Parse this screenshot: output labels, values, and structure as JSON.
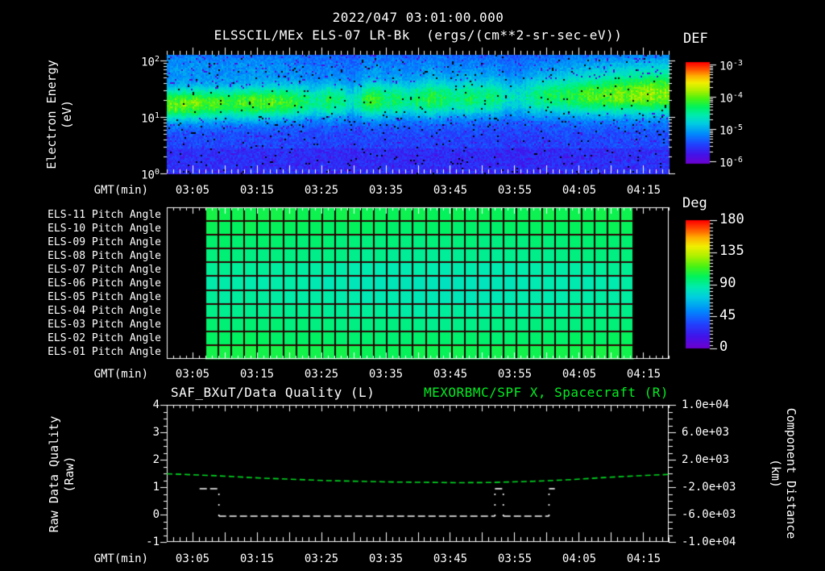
{
  "page": {
    "bg": "#000000",
    "text_color": "#ffffff",
    "accent_green": "#00ee22"
  },
  "header": {
    "title_line1": "2022/047 03:01:00.000",
    "title_line2": "ELSSCIL/MEx ELS-07 LR-Bk  (ergs/(cm**2-sr-sec-eV))"
  },
  "time_axis": {
    "label": "GMT(min)",
    "tick_labels": [
      "03:05",
      "03:15",
      "03:25",
      "03:35",
      "03:45",
      "03:55",
      "04:05",
      "04:15"
    ],
    "start_gmt": "03:01",
    "end_gmt": "04:19",
    "minutes_span": 78
  },
  "panel1": {
    "axis_title_line1": "Electron Energy",
    "axis_title_line2": "(eV)",
    "y_ticks": [
      {
        "base": "10",
        "exp": "2"
      },
      {
        "base": "10",
        "exp": "1"
      },
      {
        "base": "10",
        "exp": "0"
      }
    ],
    "colorbar": {
      "title": "DEF",
      "ticks": [
        {
          "base": "10",
          "exp": "-3"
        },
        {
          "base": "10",
          "exp": "-4"
        },
        {
          "base": "10",
          "exp": "-5"
        },
        {
          "base": "10",
          "exp": "-6"
        }
      ]
    }
  },
  "panel2": {
    "row_labels": [
      "ELS-11 Pitch Angle",
      "ELS-10 Pitch Angle",
      "ELS-09 Pitch Angle",
      "ELS-08 Pitch Angle",
      "ELS-07 Pitch Angle",
      "ELS-06 Pitch Angle",
      "ELS-05 Pitch Angle",
      "ELS-04 Pitch Angle",
      "ELS-03 Pitch Angle",
      "ELS-02 Pitch Angle",
      "ELS-01 Pitch Angle"
    ],
    "colorbar": {
      "title": "Deg",
      "ticks": [
        "180",
        "135",
        "90",
        "45",
        "0"
      ]
    }
  },
  "panel3": {
    "title_left": "SAF_BXuT/Data Quality (L)",
    "title_right": "MEXORBMC/SPF X, Spacecraft (R)",
    "left_axis": {
      "line1": "Raw Data Quality",
      "line2": "(Raw)",
      "ticks": [
        "4",
        "3",
        "2",
        "1",
        "0",
        "-1"
      ]
    },
    "right_axis": {
      "line1": "Component Distance",
      "line2": "(km)",
      "ticks": [
        "1.0e+04",
        "6.0e+03",
        "2.0e+03",
        "-2.0e+03",
        "-6.0e+03",
        "-1.0e+04"
      ]
    }
  },
  "chart_data": [
    {
      "id": "electron_energy_spectrogram",
      "type": "heatmap",
      "title": "ELSSCIL/MEx ELS-07 LR-Bk",
      "units": "ergs/(cm**2-sr-sec-eV)",
      "x_start_gmt": "03:01",
      "x_end_gmt": "04:19",
      "x_tick_labels": [
        "03:05",
        "03:15",
        "03:25",
        "03:35",
        "03:45",
        "03:55",
        "04:05",
        "04:15"
      ],
      "y_scale": "log",
      "ylabel": "Electron Energy (eV)",
      "y_range_ev": [
        1,
        126
      ],
      "y_tick_values_ev": [
        1,
        10,
        100
      ],
      "colorbar": {
        "label": "DEF",
        "max": "1e-3",
        "min": "1e-6"
      },
      "band_center_log10_ev_start_end": [
        1.22,
        1.4
      ],
      "band_envelope_min_intensity": [
        [
          0,
          0.74
        ],
        [
          3,
          0.78
        ],
        [
          6,
          0.73
        ],
        [
          10,
          0.7
        ],
        [
          14,
          0.72
        ],
        [
          18,
          0.7
        ],
        [
          21,
          0.62
        ],
        [
          23,
          0.5
        ],
        [
          25,
          0.58
        ],
        [
          27,
          0.52
        ],
        [
          29,
          0.4
        ],
        [
          31,
          0.63
        ],
        [
          33,
          0.68
        ],
        [
          34,
          0.52
        ],
        [
          36,
          0.64
        ],
        [
          37,
          0.44
        ],
        [
          39,
          0.58
        ],
        [
          41,
          0.66
        ],
        [
          43,
          0.58
        ],
        [
          45,
          0.5
        ],
        [
          47,
          0.6
        ],
        [
          49,
          0.52
        ],
        [
          51,
          0.56
        ],
        [
          53,
          0.38
        ],
        [
          55,
          0.42
        ],
        [
          57,
          0.5
        ],
        [
          59,
          0.55
        ],
        [
          62,
          0.62
        ],
        [
          66,
          0.7
        ],
        [
          70,
          0.76
        ],
        [
          74,
          0.82
        ],
        [
          78,
          0.8
        ]
      ]
    },
    {
      "id": "pitch_angle_panels",
      "type": "heatmap",
      "rows": [
        "ELS-11",
        "ELS-10",
        "ELS-09",
        "ELS-08",
        "ELS-07",
        "ELS-06",
        "ELS-05",
        "ELS-04",
        "ELS-03",
        "ELS-02",
        "ELS-01"
      ],
      "row_mean_pitch_angle_deg": [
        105,
        102.5,
        99,
        96,
        91.5,
        88.5,
        90,
        93.5,
        97.5,
        101,
        105.5
      ],
      "data_start_gmt": "03:07",
      "data_end_gmt": "04:13",
      "cell_minutes": 2,
      "n_time_cells": 33,
      "colorbar": {
        "label": "Deg",
        "min": 0,
        "max": 180,
        "tick_values": [
          180,
          135,
          90,
          45,
          0
        ]
      }
    },
    {
      "id": "quality_and_distance",
      "type": "line",
      "left_axis": {
        "label": "Raw Data Quality (Raw)",
        "ylim": [
          -1,
          4
        ]
      },
      "right_axis": {
        "label": "Component Distance (km)",
        "ylim": [
          -10000,
          10000
        ]
      },
      "series": [
        {
          "name": "SAF_BXuT/Data Quality (L)",
          "axis": "left",
          "color": "#ffffff",
          "style": "dashed",
          "segments_value_minrange": [
            {
              "value": 1,
              "t": [
                5.1,
                8.1
              ]
            },
            {
              "value": 0,
              "t": [
                8.1,
                51.0
              ]
            },
            {
              "value": 1,
              "t": [
                51.0,
                52.3
              ]
            },
            {
              "value": 0,
              "t": [
                52.3,
                59.4
              ]
            },
            {
              "value": 1,
              "t": [
                59.4,
                60.3
              ]
            }
          ]
        },
        {
          "name": "MEXORBMC/SPF X, Spacecraft (R)",
          "axis": "right",
          "color": "#00dd22",
          "style": "dashed",
          "points_min_km": [
            [
              0,
              -50
            ],
            [
              8,
              -350
            ],
            [
              15,
              -700
            ],
            [
              25,
              -1050
            ],
            [
              35,
              -1250
            ],
            [
              45,
              -1350
            ],
            [
              50,
              -1330
            ],
            [
              57,
              -1150
            ],
            [
              63,
              -900
            ],
            [
              68,
              -600
            ],
            [
              73,
              -350
            ],
            [
              78,
              -150
            ]
          ]
        }
      ]
    }
  ]
}
